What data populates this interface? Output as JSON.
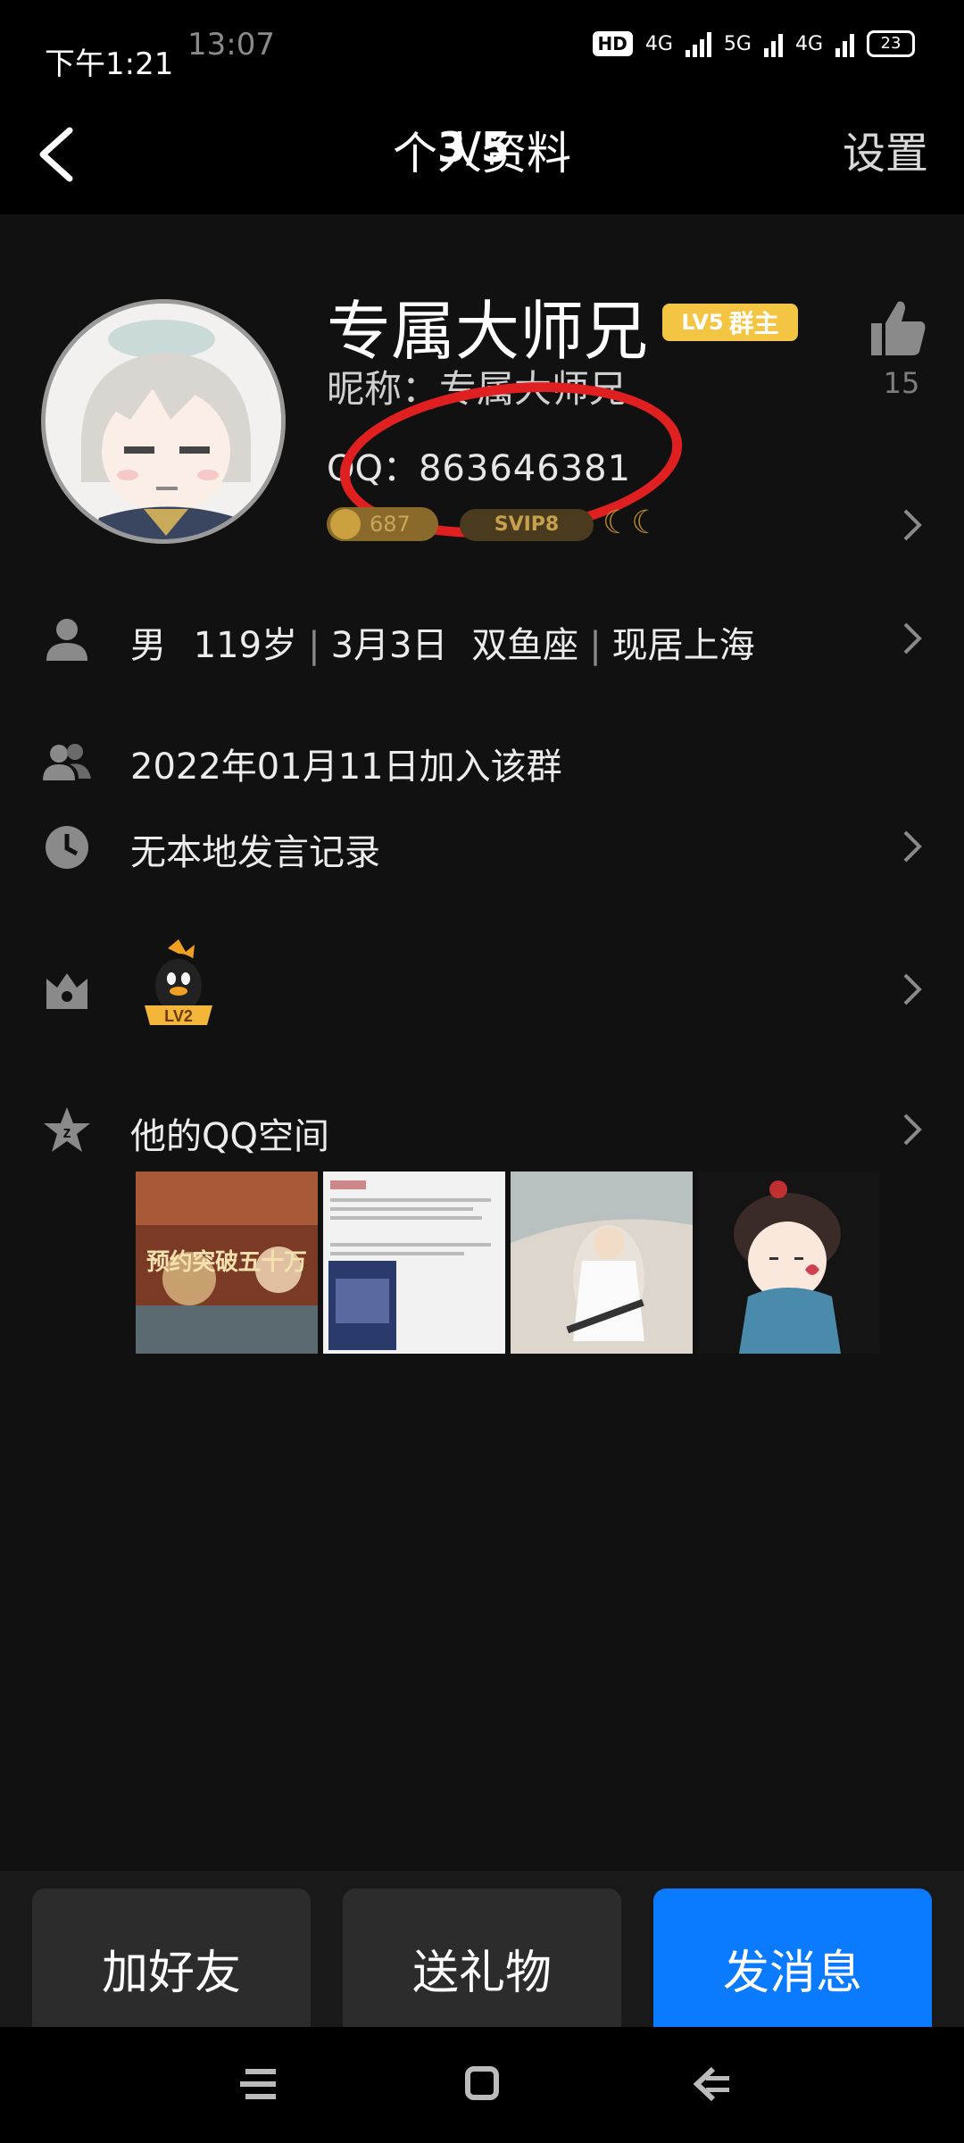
{
  "status_bar": {
    "time": "下午1:21",
    "ghost_time": "13:07",
    "network_1": "4G",
    "network_2": "5G",
    "network_3": "4G",
    "hd": "HD",
    "battery": "23"
  },
  "header": {
    "title": "个人资料",
    "title_overlay": "3/5",
    "settings_label": "设置"
  },
  "profile": {
    "name": "专属大师兄",
    "badge_level": "LV5",
    "badge_role": "群主",
    "like_count": "15",
    "nickname_label": "昵称：",
    "nickname_value": "专属大师兄",
    "qq_label": "QQ：",
    "qq_number": "863646381",
    "coin_tag": "687",
    "svip_tag": "SVIP8"
  },
  "rows": {
    "basic": {
      "gender": "男",
      "age": "119岁",
      "birthday": "3月3日",
      "zodiac": "双鱼座",
      "location": "现居上海"
    },
    "joined": "2022年01月11日加入该群",
    "speech": "无本地发言记录",
    "group_level": "LV2",
    "qzone": "他的QQ空间"
  },
  "photos": {
    "photo1_text": "预约突破五十万"
  },
  "buttons": {
    "add_friend": "加好友",
    "send_gift": "送礼物",
    "send_message": "发消息"
  },
  "colors": {
    "accent_blue": "#0a7aff",
    "badge_gold": "#f3c543",
    "highlight_red": "#e02020",
    "background": "#111111"
  }
}
